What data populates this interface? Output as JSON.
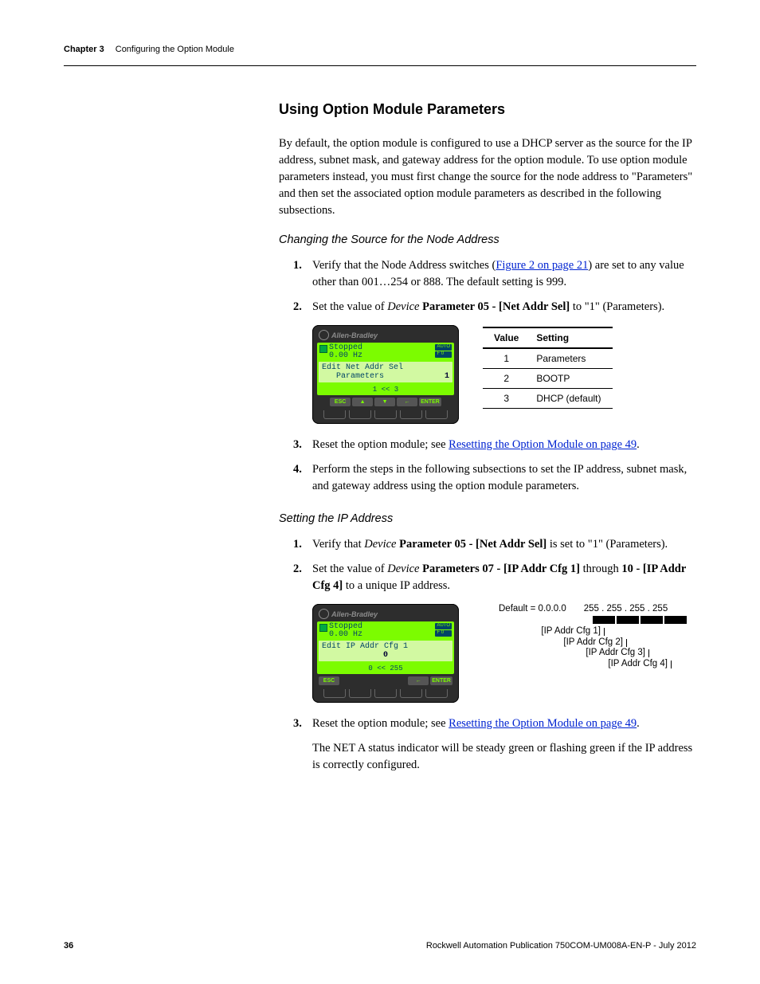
{
  "header": {
    "chapter": "Chapter 3",
    "title": "Configuring the Option Module"
  },
  "section_heading": "Using Option Module Parameters",
  "intro_para": "By default, the option module is configured to use a DHCP server as the source for the IP address, subnet mask, and gateway address for the option module. To use option module parameters instead, you must first change the source for the node address to \"Parameters\" and then set the associated option module parameters as described in the following subsections.",
  "sub1_heading": "Changing the Source for the Node Address",
  "sub1": {
    "s1a": "Verify that the Node Address switches (",
    "s1_link": "Figure 2 on page 21",
    "s1b": ") are set to any value other than 001…254 or 888. The default setting is 999.",
    "s2a": "Set the value of ",
    "s2_i": "Device",
    "s2b": " ",
    "s2_bold": "Parameter 05 - [Net Addr Sel]",
    "s2c": " to \"1\" (Parameters).",
    "s3a": "Reset the option module; see ",
    "s3_link": "Resetting the Option Module on page 49",
    "s3b": ".",
    "s4": "Perform the steps in the following subsections to set the IP address, subnet mask, and gateway address using the option module parameters."
  },
  "him1": {
    "brand": "Allen-Bradley",
    "status": "Stopped",
    "freq": "0.00 Hz",
    "badge1": "AUTO",
    "badge2": "F 0",
    "line1": "Edit Net Addr Sel",
    "line2": "Parameters",
    "line2_right": "1",
    "nav": "1  <<  3",
    "btn_esc": "ESC",
    "btn_up": "▲",
    "btn_down": "▼",
    "btn_left": "←",
    "btn_enter": "ENTER"
  },
  "table1": {
    "h1": "Value",
    "h2": "Setting",
    "r1v": "1",
    "r1s": "Parameters",
    "r2v": "2",
    "r2s": "BOOTP",
    "r3v": "3",
    "r3s": "DHCP (default)"
  },
  "sub2_heading": "Setting the IP Address",
  "sub2": {
    "s1a": "Verify that ",
    "s1_i": "Device",
    "s1b": " ",
    "s1_bold": "Parameter 05 - [Net Addr Sel]",
    "s1c": " is set to \"1\" (Parameters).",
    "s2a": "Set the value of ",
    "s2_i": "Device",
    "s2b": " ",
    "s2_bold1": "Parameters 07 - [IP Addr Cfg 1]",
    "s2c": " through ",
    "s2_bold2": "10 - [IP Addr Cfg 4]",
    "s2d": " to a unique IP address.",
    "s3a": "Reset the option module; see ",
    "s3_link": "Resetting the Option Module on page 49",
    "s3b": ".",
    "s3_para": "The NET A status indicator will be steady green or flashing green if the IP address is correctly configured."
  },
  "him2": {
    "brand": "Allen-Bradley",
    "status": "Stopped",
    "freq": "0.00 Hz",
    "badge1": "AUTO",
    "badge2": "F 0",
    "line1": "Edit IP Addr Cfg 1",
    "line2": "0",
    "nav": "0  <<  255",
    "btn_esc": "ESC",
    "btn_left": "←",
    "btn_enter": "ENTER"
  },
  "ipdiag": {
    "default": "Default = 0.0.0.0",
    "v255": "255 . 255 . 255 . 255",
    "l1": "[IP Addr Cfg 1]",
    "l2": "[IP Addr Cfg 2]",
    "l3": "[IP Addr Cfg 3]",
    "l4": "[IP Addr Cfg 4]"
  },
  "footer": {
    "page": "36",
    "pub": "Rockwell Automation Publication 750COM-UM008A-EN-P - July 2012"
  }
}
